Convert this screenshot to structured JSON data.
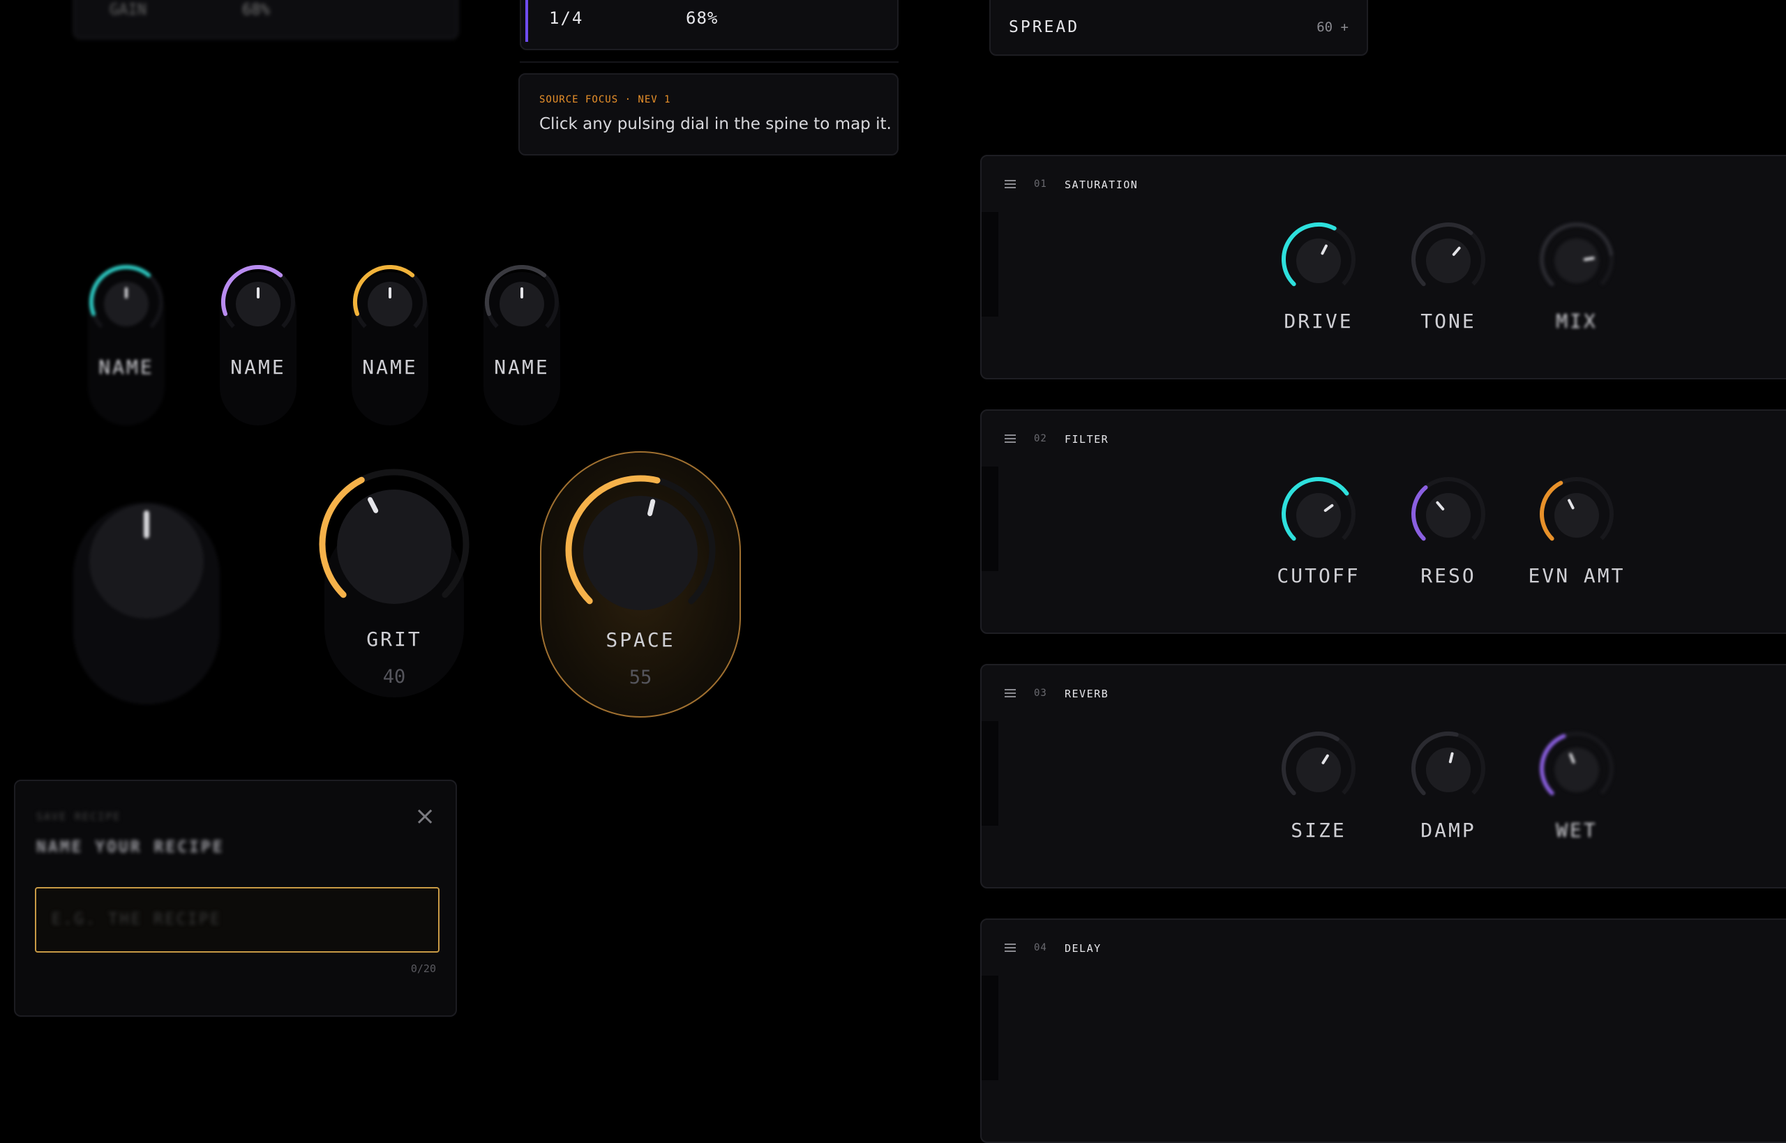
{
  "top_left": {
    "col_a": "GAIN",
    "col_b": "68%"
  },
  "progress": {
    "step": "1/4",
    "percent": "68%",
    "accent": "#6f4cf0"
  },
  "hint": {
    "tag": "SOURCE FOCUS · NEV 1",
    "text": "Click any pulsing dial in the spine to map it."
  },
  "spread": {
    "label": "SPREAD",
    "value": "60 +"
  },
  "mini_knobs": [
    {
      "label": "NAME",
      "color": "#2dc9c2"
    },
    {
      "label": "NAME",
      "color": "#b98cf0"
    },
    {
      "label": "NAME",
      "color": "#f2b33a"
    },
    {
      "label": "NAME",
      "color": "#3a3a40"
    }
  ],
  "macro": {
    "grit": {
      "label": "GRIT",
      "value": "40",
      "level": 0.4,
      "color": "#f6b24a"
    },
    "space": {
      "label": "SPACE",
      "value": "55",
      "level": 0.55,
      "color": "#f6b24a"
    }
  },
  "modal": {
    "eyebrow": "SAVE RECIPE",
    "title": "NAME YOUR RECIPE",
    "placeholder": "E.G. THE RECIPE",
    "counter": "0/20",
    "close": "×"
  },
  "sections": [
    {
      "num": "01",
      "name": "SATURATION",
      "knobs": [
        {
          "label": "DRIVE",
          "color": "#2ee0dd",
          "level": 0.6
        },
        {
          "label": "TONE",
          "color": "#2a2a30",
          "level": 0.65
        },
        {
          "label": "MIX",
          "color": "#2a2a30",
          "level": 0.8
        }
      ]
    },
    {
      "num": "02",
      "name": "FILTER",
      "knobs": [
        {
          "label": "CUTOFF",
          "color": "#2ee0dd",
          "level": 0.7
        },
        {
          "label": "RESO",
          "color": "#8a5fe0",
          "level": 0.35
        },
        {
          "label": "EVN AMT",
          "color": "#e8912a",
          "level": 0.4
        }
      ]
    },
    {
      "num": "03",
      "name": "REVERB",
      "knobs": [
        {
          "label": "SIZE",
          "color": "#2a2a30",
          "level": 0.62
        },
        {
          "label": "DAMP",
          "color": "#2a2a30",
          "level": 0.55
        },
        {
          "label": "WET",
          "color": "#8a5fe0",
          "level": 0.42
        }
      ]
    },
    {
      "num": "04",
      "name": "DELAY",
      "knobs": []
    }
  ]
}
